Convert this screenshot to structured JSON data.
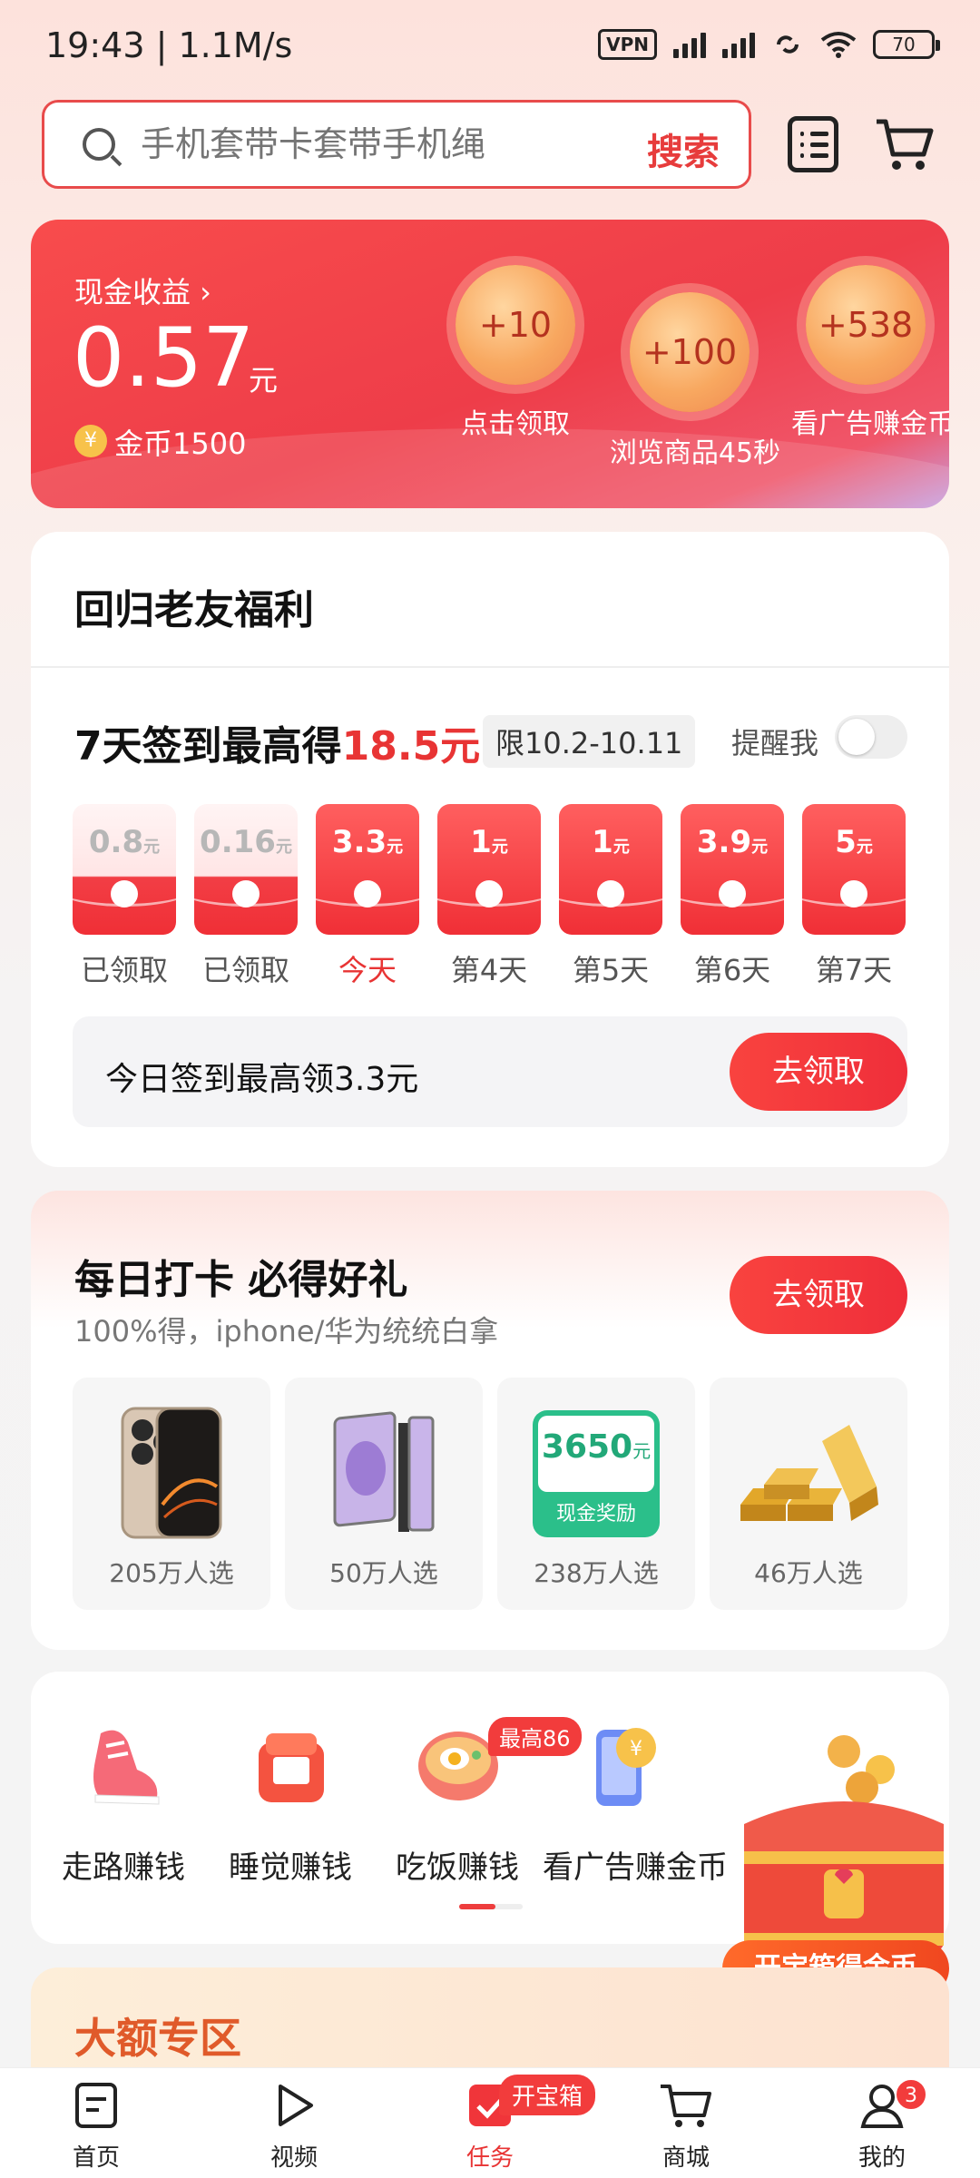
{
  "status_bar": {
    "time": "19:43 | 1.1M/s",
    "vpn": "VPN",
    "battery": "70"
  },
  "search": {
    "placeholder": "手机套带卡套带手机绳",
    "button": "搜索"
  },
  "earnings": {
    "label": "现金收益 ›",
    "amount": "0.57",
    "unit": "元",
    "coin_symbol": "¥",
    "coins": "金币1500",
    "rewards": [
      {
        "value": "+10",
        "caption": "点击领取"
      },
      {
        "value": "+100",
        "caption": "浏览商品45秒"
      },
      {
        "value": "+538",
        "caption": "看广告赚金币"
      }
    ]
  },
  "friend_card": {
    "title": "回归老友福利",
    "sign_prefix": "7天签到最高得",
    "sign_amount": "18.5元",
    "limit": "限10.2-10.11",
    "remind": "提醒我",
    "days": [
      {
        "value": "0.8",
        "unit": "元",
        "label": "已领取",
        "claimed": true
      },
      {
        "value": "0.16",
        "unit": "元",
        "label": "已领取",
        "claimed": true
      },
      {
        "value": "3.3",
        "unit": "元",
        "label": "今天",
        "claimed": false
      },
      {
        "value": "1",
        "unit": "元",
        "label": "第4天",
        "claimed": false
      },
      {
        "value": "1",
        "unit": "元",
        "label": "第5天",
        "claimed": false
      },
      {
        "value": "3.9",
        "unit": "元",
        "label": "第6天",
        "claimed": false
      },
      {
        "value": "5",
        "unit": "元",
        "label": "第7天",
        "claimed": false
      }
    ],
    "today_text": "今日签到最高领3.3元",
    "claim_button": "去领取"
  },
  "daily_card": {
    "title": "每日打卡 必得好礼",
    "subtitle": "100%得，iphone/华为统统白拿",
    "claim_button": "去领取",
    "prizes": [
      {
        "name": "phone-image",
        "count": "205万人选"
      },
      {
        "name": "foldable-phone-image",
        "count": "50万人选"
      },
      {
        "name": "cash-reward-card",
        "count": "238万人选",
        "cash_amount": "3650",
        "cash_unit": "元",
        "cash_label": "现金奖励"
      },
      {
        "name": "gold-bars-image",
        "count": "46万人选"
      }
    ]
  },
  "tasks": {
    "items": [
      {
        "label": "走路赚钱",
        "icon": "sneaker-icon"
      },
      {
        "label": "睡觉赚钱",
        "icon": "alarm-clock-icon"
      },
      {
        "label": "吃饭赚钱",
        "icon": "noodle-bowl-icon"
      },
      {
        "label": "看广告赚金币",
        "icon": "phone-coin-icon"
      }
    ],
    "max_tag": "最高86",
    "chest_label": "开宝箱得金币"
  },
  "big_zone": {
    "title": "大额专区"
  },
  "nav": {
    "items": [
      {
        "label": "首页",
        "icon": "home-icon"
      },
      {
        "label": "视频",
        "icon": "play-icon"
      },
      {
        "label": "任务",
        "icon": "task-check-icon"
      },
      {
        "label": "商城",
        "icon": "cart-icon"
      },
      {
        "label": "我的",
        "icon": "profile-icon"
      }
    ],
    "task_badge": "开宝箱",
    "profile_count": "3"
  },
  "colors": {
    "accent": "#ee3d3d",
    "earn_card": "#f84c4c",
    "coin": "#f7c24a",
    "cash_green": "#2bbf8a"
  }
}
